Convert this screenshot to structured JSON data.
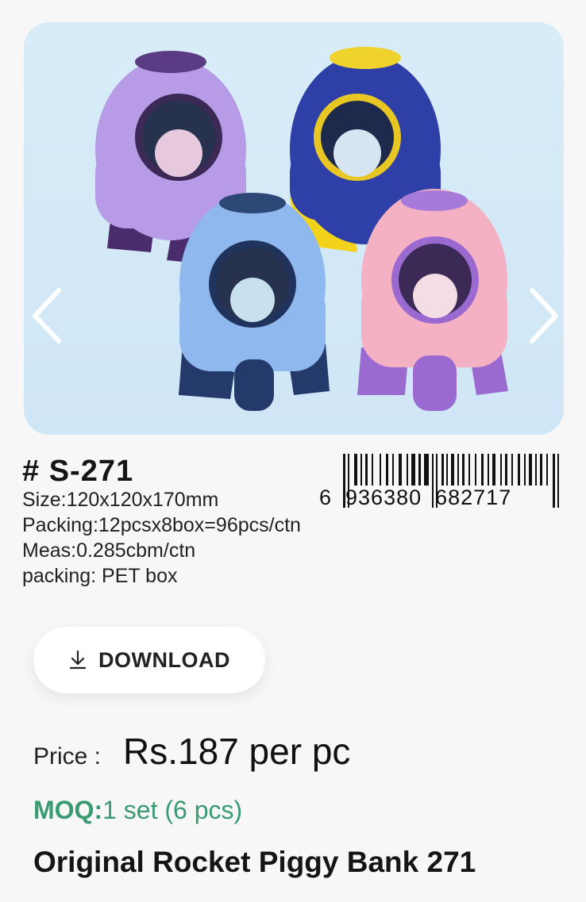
{
  "product": {
    "sku": "# S-271",
    "size": "Size:120x120x170mm",
    "packing": "Packing:12pcsx8box=96pcs/ctn",
    "meas": "Meas:0.285cbm/ctn",
    "packing_type": "packing: PET box",
    "barcode_digits": "6  936380  682717",
    "title": "Original Rocket Piggy Bank 271"
  },
  "download": {
    "label": "DOWNLOAD",
    "icon": "download-icon"
  },
  "price": {
    "label": "Price :",
    "value": "Rs.187 per pc"
  },
  "moq": {
    "label": "MOQ:",
    "value": "1 set (6 pcs)"
  },
  "carousel": {
    "prev_icon": "chevron-left-icon",
    "next_icon": "chevron-right-icon"
  },
  "colors": {
    "accent_moq": "#3a9a72"
  }
}
